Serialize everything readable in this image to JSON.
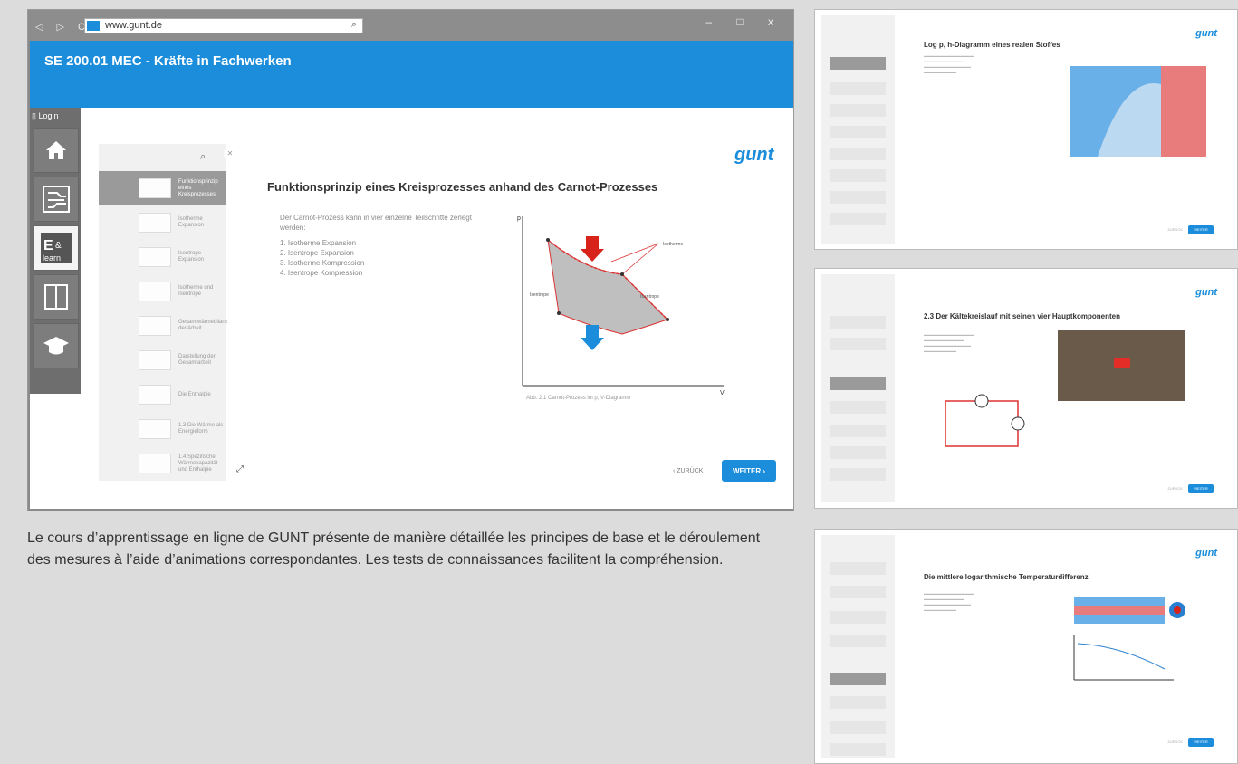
{
  "browser": {
    "url": "www.gunt.de",
    "nav_arrows": "◁ ▷ C",
    "controls": "– □ x"
  },
  "app": {
    "title": "SE 200.01 MEC - Kräfte in Fachwerken",
    "login": "Login"
  },
  "page": {
    "heading": "Funktionsprinzip eines Kreisprozesses anhand des Carnot-Prozesses",
    "intro": "Der Carnot-Prozess kann in vier einzelne Teilschritte zerlegt werden:",
    "steps": [
      "1. Isotherme Expansion",
      "2. Isentrope Expansion",
      "3. Isotherme Kompression",
      "4. Isentrope Kompression"
    ],
    "figure_caption": "Abb. 2.1 Carnot-Prozess im p, V-Diagramm",
    "figure_labels": {
      "isotherme": "Isotherme",
      "isentrope_left": "Isentrope",
      "isentrope_right": "Isentrope",
      "p_axis": "p",
      "v_axis": "V"
    },
    "back_label": "ZURÜCK",
    "next_label": "WEITER"
  },
  "toc": {
    "items": [
      "Funktionsprinzip eines Kreisprozesses",
      "Isotherme Expansion",
      "Isentrope Expansion",
      "Isotherme und Isentrope",
      "Gesamtwärmebilanz der Arbeit",
      "Darstellung der Gesamtarbeit",
      "Die Enthalpie",
      "1.3 Die Wärme als Energieform",
      "1.4 Spezifische Wärmekapazität und Enthalpie"
    ]
  },
  "logo_text": "gunt",
  "caption": "Le cours d’apprentissage en ligne de GUNT présente de manière détaillée les principes de base et le déroulement des mesures à l’aide d’animations correspondantes. Les tests de connaissances facilitent la compréhension.",
  "thumbs": [
    {
      "heading": "Log p, h-Diagramm eines realen Stoffes",
      "next": "WEITER",
      "back": "ZURÜCK"
    },
    {
      "heading": "2.3  Der Kältekreislauf mit seinen vier Hauptkomponenten",
      "next": "WEITER",
      "back": "ZURÜCK"
    },
    {
      "heading": "Die mittlere logarithmische Temperaturdifferenz",
      "next": "WEITER",
      "back": "ZURÜCK"
    }
  ]
}
